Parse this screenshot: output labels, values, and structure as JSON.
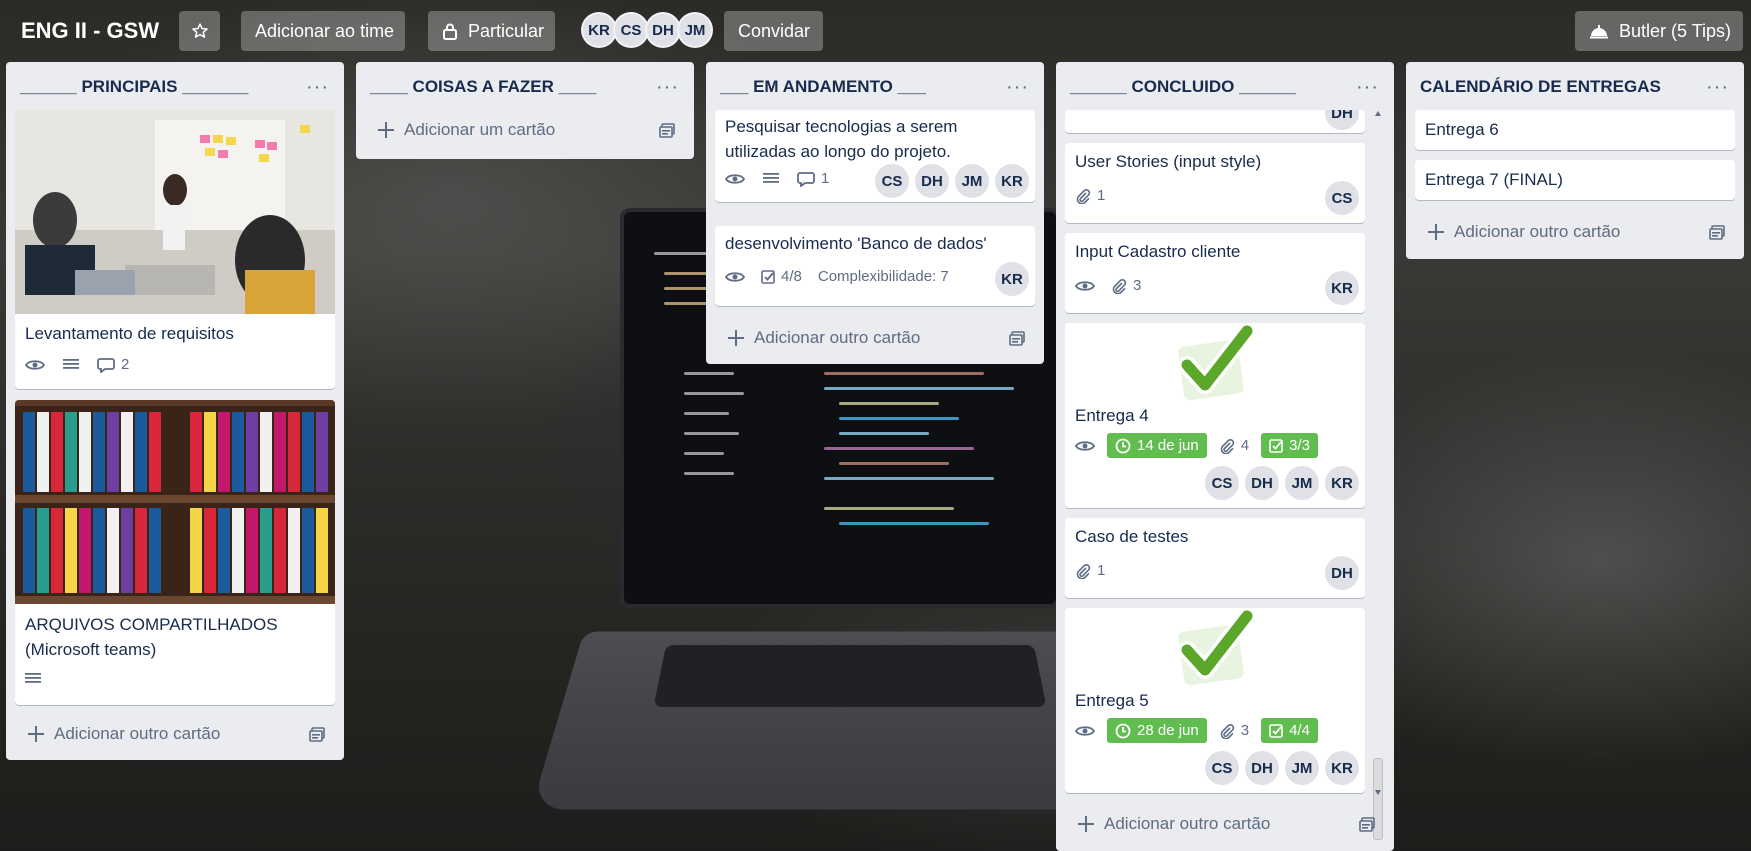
{
  "header": {
    "board_title": "ENG II - GSW",
    "add_team_label": "Adicionar ao time",
    "visibility_label": "Particular",
    "members": [
      "KR",
      "CS",
      "DH",
      "JM"
    ],
    "invite_label": "Convidar",
    "butler_label": "Butler (5 Tips)"
  },
  "lists": [
    {
      "title": "______ PRINCIPAIS _______",
      "cards": [
        {
          "title": "Levantamento de requisitos",
          "comments": "2"
        },
        {
          "title_line1": "ARQUIVOS COMPARTILHADOS",
          "title_line2": "(Microsoft teams)"
        }
      ],
      "add_label": "Adicionar outro cartão"
    },
    {
      "title": "____ COISAS A FAZER ____",
      "add_label": "Adicionar um cartão"
    },
    {
      "title": "___ EM ANDAMENTO ___",
      "cards": [
        {
          "title_line1": "Pesquisar tecnologias a serem",
          "title_line2": "utilizadas ao longo do projeto.",
          "comments": "1",
          "members": [
            "CS",
            "DH",
            "JM",
            "KR"
          ]
        },
        {
          "title": "desenvolvimento 'Banco de dados'",
          "checklist": "4/8",
          "custom_field": "Complexibilidade: 7",
          "members": [
            "KR"
          ]
        }
      ],
      "add_label": "Adicionar outro cartão"
    },
    {
      "title": "______ CONCLUIDO ______",
      "cards": [
        {
          "top_partial_member": "DH"
        },
        {
          "title": "User Stories (input style)",
          "attachments": "1",
          "members": [
            "CS"
          ]
        },
        {
          "title": "Input Cadastro cliente",
          "attachments": "3",
          "members": [
            "KR"
          ]
        },
        {
          "title": "Entrega 4",
          "due": "14 de jun",
          "attachments": "4",
          "checklist": "3/3",
          "members": [
            "CS",
            "DH",
            "JM",
            "KR"
          ]
        },
        {
          "title": "Caso de testes",
          "attachments": "1",
          "members": [
            "DH"
          ]
        },
        {
          "title": "Entrega 5",
          "due": "28 de jun",
          "attachments": "3",
          "checklist": "4/4",
          "members": [
            "CS",
            "DH",
            "JM",
            "KR"
          ]
        }
      ],
      "add_label": "Adicionar outro cartão"
    },
    {
      "title": "CALENDÁRIO DE ENTREGAS",
      "cards": [
        {
          "title": "Entrega 6"
        },
        {
          "title": "Entrega 7 (FINAL)"
        }
      ],
      "add_label": "Adicionar outro cartão"
    }
  ],
  "colors": {
    "list_bg": "#ebecf0",
    "green_badge": "#61bd4f",
    "text": "#172b4d",
    "muted": "#5e6c84"
  }
}
